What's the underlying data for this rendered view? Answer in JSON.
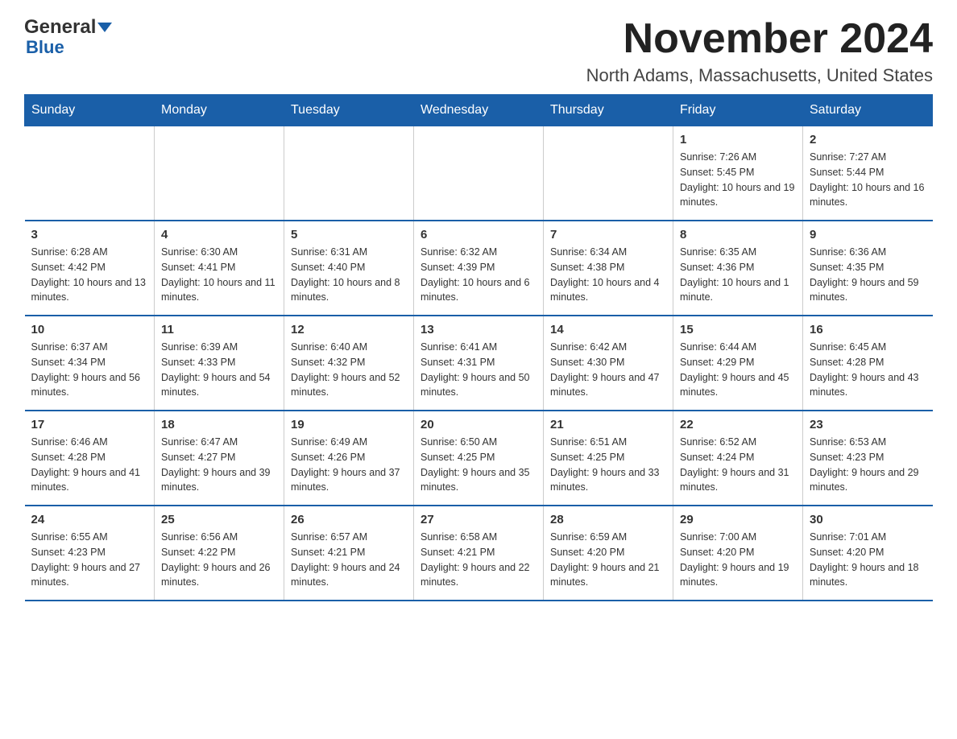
{
  "header": {
    "logo_general": "General",
    "logo_blue": "Blue",
    "month_title": "November 2024",
    "location": "North Adams, Massachusetts, United States"
  },
  "weekdays": [
    "Sunday",
    "Monday",
    "Tuesday",
    "Wednesday",
    "Thursday",
    "Friday",
    "Saturday"
  ],
  "weeks": [
    [
      {
        "day": "",
        "info": ""
      },
      {
        "day": "",
        "info": ""
      },
      {
        "day": "",
        "info": ""
      },
      {
        "day": "",
        "info": ""
      },
      {
        "day": "",
        "info": ""
      },
      {
        "day": "1",
        "info": "Sunrise: 7:26 AM\nSunset: 5:45 PM\nDaylight: 10 hours and 19 minutes."
      },
      {
        "day": "2",
        "info": "Sunrise: 7:27 AM\nSunset: 5:44 PM\nDaylight: 10 hours and 16 minutes."
      }
    ],
    [
      {
        "day": "3",
        "info": "Sunrise: 6:28 AM\nSunset: 4:42 PM\nDaylight: 10 hours and 13 minutes."
      },
      {
        "day": "4",
        "info": "Sunrise: 6:30 AM\nSunset: 4:41 PM\nDaylight: 10 hours and 11 minutes."
      },
      {
        "day": "5",
        "info": "Sunrise: 6:31 AM\nSunset: 4:40 PM\nDaylight: 10 hours and 8 minutes."
      },
      {
        "day": "6",
        "info": "Sunrise: 6:32 AM\nSunset: 4:39 PM\nDaylight: 10 hours and 6 minutes."
      },
      {
        "day": "7",
        "info": "Sunrise: 6:34 AM\nSunset: 4:38 PM\nDaylight: 10 hours and 4 minutes."
      },
      {
        "day": "8",
        "info": "Sunrise: 6:35 AM\nSunset: 4:36 PM\nDaylight: 10 hours and 1 minute."
      },
      {
        "day": "9",
        "info": "Sunrise: 6:36 AM\nSunset: 4:35 PM\nDaylight: 9 hours and 59 minutes."
      }
    ],
    [
      {
        "day": "10",
        "info": "Sunrise: 6:37 AM\nSunset: 4:34 PM\nDaylight: 9 hours and 56 minutes."
      },
      {
        "day": "11",
        "info": "Sunrise: 6:39 AM\nSunset: 4:33 PM\nDaylight: 9 hours and 54 minutes."
      },
      {
        "day": "12",
        "info": "Sunrise: 6:40 AM\nSunset: 4:32 PM\nDaylight: 9 hours and 52 minutes."
      },
      {
        "day": "13",
        "info": "Sunrise: 6:41 AM\nSunset: 4:31 PM\nDaylight: 9 hours and 50 minutes."
      },
      {
        "day": "14",
        "info": "Sunrise: 6:42 AM\nSunset: 4:30 PM\nDaylight: 9 hours and 47 minutes."
      },
      {
        "day": "15",
        "info": "Sunrise: 6:44 AM\nSunset: 4:29 PM\nDaylight: 9 hours and 45 minutes."
      },
      {
        "day": "16",
        "info": "Sunrise: 6:45 AM\nSunset: 4:28 PM\nDaylight: 9 hours and 43 minutes."
      }
    ],
    [
      {
        "day": "17",
        "info": "Sunrise: 6:46 AM\nSunset: 4:28 PM\nDaylight: 9 hours and 41 minutes."
      },
      {
        "day": "18",
        "info": "Sunrise: 6:47 AM\nSunset: 4:27 PM\nDaylight: 9 hours and 39 minutes."
      },
      {
        "day": "19",
        "info": "Sunrise: 6:49 AM\nSunset: 4:26 PM\nDaylight: 9 hours and 37 minutes."
      },
      {
        "day": "20",
        "info": "Sunrise: 6:50 AM\nSunset: 4:25 PM\nDaylight: 9 hours and 35 minutes."
      },
      {
        "day": "21",
        "info": "Sunrise: 6:51 AM\nSunset: 4:25 PM\nDaylight: 9 hours and 33 minutes."
      },
      {
        "day": "22",
        "info": "Sunrise: 6:52 AM\nSunset: 4:24 PM\nDaylight: 9 hours and 31 minutes."
      },
      {
        "day": "23",
        "info": "Sunrise: 6:53 AM\nSunset: 4:23 PM\nDaylight: 9 hours and 29 minutes."
      }
    ],
    [
      {
        "day": "24",
        "info": "Sunrise: 6:55 AM\nSunset: 4:23 PM\nDaylight: 9 hours and 27 minutes."
      },
      {
        "day": "25",
        "info": "Sunrise: 6:56 AM\nSunset: 4:22 PM\nDaylight: 9 hours and 26 minutes."
      },
      {
        "day": "26",
        "info": "Sunrise: 6:57 AM\nSunset: 4:21 PM\nDaylight: 9 hours and 24 minutes."
      },
      {
        "day": "27",
        "info": "Sunrise: 6:58 AM\nSunset: 4:21 PM\nDaylight: 9 hours and 22 minutes."
      },
      {
        "day": "28",
        "info": "Sunrise: 6:59 AM\nSunset: 4:20 PM\nDaylight: 9 hours and 21 minutes."
      },
      {
        "day": "29",
        "info": "Sunrise: 7:00 AM\nSunset: 4:20 PM\nDaylight: 9 hours and 19 minutes."
      },
      {
        "day": "30",
        "info": "Sunrise: 7:01 AM\nSunset: 4:20 PM\nDaylight: 9 hours and 18 minutes."
      }
    ]
  ]
}
